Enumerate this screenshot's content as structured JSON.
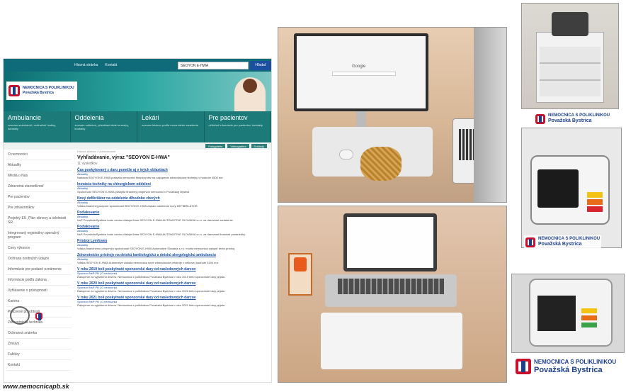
{
  "website": {
    "topbar": [
      "Hlavná stránka",
      "Kontakt"
    ],
    "search_value": "SEOYON E-HWA",
    "search_button": "Hľadať",
    "logo_line1": "NEMOCNICA S POLIKLINIKOU",
    "logo_line2": "Považská Bystrica",
    "nav": [
      {
        "title": "Ambulancie",
        "sub": "zoznam ambulancií, ordinačné hodiny, kontakty"
      },
      {
        "title": "Oddelenia",
        "sub": "zoznam oddelení, pôsobiaci lekári a sestry, kontakty"
      },
      {
        "title": "Lekári",
        "sub": "zoznam lekárov podľa mena alebo zaradenia"
      },
      {
        "title": "Pre pacientov",
        "sub": "užitočné informácie pre pacientov, kontakty"
      }
    ],
    "tabs": [
      "Fotogaléria",
      "Videogaléria",
      "Doklady"
    ],
    "sidebar": [
      "O nemocnici",
      "Aktuality",
      "Médiá o Nás",
      "Zdravotná starostlivosť",
      "Pre pacientov",
      "Pre zdravotníkov",
      "Projekty EÚ, Plán obnovy a odolnosti SR",
      "Integrovaný regionálny operačný program",
      "Ceny výkonov",
      "Ochrana osobných údajov",
      "Informácie pre podané oznámenie",
      "Informácie podľa zákona",
      "Vyhlásenie o prístupnosti",
      "Kariéra",
      "Pracovné príležitosti",
      "Zdravotnícka technika",
      "Ochranná známka",
      "Zmluvy",
      "Faktúry",
      "Kontakt"
    ],
    "breadcrumb": "Hlavná stránka › Vyhľadávanie",
    "heading": "Vyhľadávanie, výraz \"SEOYON E-HWA\"",
    "count": "11 výsledkov",
    "results": [
      {
        "title": "Čas poskytovaný z daru pomôže aj v iných oblastiach",
        "cat": "Aktuality",
        "desc": "Nadácia SEOYON E-HWA poskytla nemocnici finančný dar na zakúpenie zdravotníckej techniky v hodnote 4500 eur."
      },
      {
        "title": "Inovácia techniky na chirurgickom oddelení",
        "cat": "Aktuality",
        "desc": "Spoločnosť SEOYON E-HWA poskytla finančný príspevok nemocnici v Považskej Bystrici."
      },
      {
        "title": "Nový defibrilátor na oddelenie dlhodobo chorých",
        "cat": "Aktuality",
        "desc": "Vďaka finančnej podpore spoločnosti SEOYON E-HWA získalo oddelenie nový DEFIBRILÁTOR."
      },
      {
        "title": "Poďakovanie",
        "cat": "Aktuality",
        "desc": "NsP Považská Bystrica touto cestou ďakuje firme SEOYON E-HWA AUTOMOTIVE SLOVAKIA s.r.o. za darované zariadenie."
      },
      {
        "title": "Poďakovanie",
        "cat": "Aktuality",
        "desc": "NsP Považská Bystrica touto cestou ďakuje firme SEOYON E-HWA AUTOMOTIVE SLOVAKIA s.r.o. za darované finančné prostriedky."
      },
      {
        "title": "Prístroj Lymfoven",
        "cat": "Aktuality",
        "desc": "Vďaka finančnému príspevku spoločnosti SEOYON E-HWA Automotive Slovakia s.r.o. mohla nemocnica zakúpiť tento prístroj."
      },
      {
        "title": "Zdravotnícke prístroje na detskú kardiologickú a detskú alergologickú ambulanciu",
        "cat": "Aktuality",
        "desc": "Vďaka SEOYON E-HWA Automotive získala nemocnica nové zdravotnícke prístroje v celkovej hodnote 5104 eur."
      },
      {
        "title": "V roku 2019 boli poskytnuté sponzorské dary od nasledovných darcov",
        "cat": "Sponzori NsP PB | O nemocnici",
        "desc": "Ďakujeme za vyjadrenú dôveru. Nemocnica s poliklinikou Považská Bystrica v roku 2019 tieto sponzorské dary prijala."
      },
      {
        "title": "V roku 2020 boli poskytnuté sponzorské dary od nasledovných darcov",
        "cat": "Sponzori NsP PB | O nemocnici",
        "desc": "Ďakujeme za vyjadrenú dôveru. Nemocnica s poliklinikou Považská Bystrica v roku 2020 tieto sponzorské dary prijala."
      },
      {
        "title": "V roku 2021 boli poskytnuté sponzorské dary od nasledovných darcov",
        "cat": "Sponzori NsP PB | O nemocnici",
        "desc": "Ďakujeme za vyjadrenú dôveru. Nemocnica s poliklinikou Považská Bystrica v roku 2021 tieto sponzorské dary prijala."
      }
    ]
  },
  "footer_url": "www.nemocnicapb.sk",
  "brand": {
    "name": "NEMOCNICA S POLIKLINIKOU",
    "city": "Považská Bystrica"
  },
  "screen_text": "Google",
  "colors": {
    "accent": "#1c7b78",
    "brand_red": "#c8102e",
    "brand_blue": "#1d3f8a"
  }
}
